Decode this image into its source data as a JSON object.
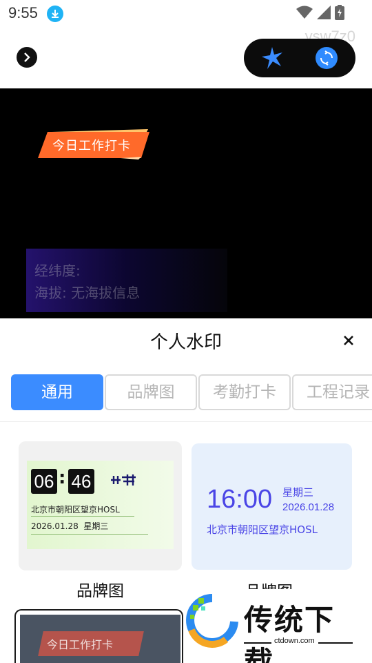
{
  "status": {
    "time": "9:55"
  },
  "top": {
    "faint_code": "ysw7z0"
  },
  "preview": {
    "tag": "今日工作打卡",
    "line1": "经纬度:",
    "line2": "海拔: 无海拔信息"
  },
  "sheet": {
    "title": "个人水印",
    "tabs": [
      {
        "label": "通用",
        "active": true
      },
      {
        "label": "品牌图",
        "active": false
      },
      {
        "label": "考勤打卡",
        "active": false
      },
      {
        "label": "工程记录",
        "active": false
      }
    ]
  },
  "cards": {
    "brand": {
      "hour": "06",
      "minute": "46",
      "address": "北京市朝阳区望京HOSL",
      "date": "2026.01.28",
      "weekday": "星期三",
      "label": "品牌图"
    },
    "general": {
      "time": "16:00",
      "weekday": "星期三",
      "date": "2026.01.28",
      "address": "北京市朝阳区望京HOSL",
      "label": "品牌图"
    },
    "attendance": {
      "tag": "今日工作打卡"
    }
  },
  "watermark": {
    "title": "传统下载",
    "url": "ctdown.com"
  },
  "colors": {
    "accent": "#3b8cff",
    "tag_orange": "#ff6a2a",
    "general_text": "#4a45e6"
  }
}
